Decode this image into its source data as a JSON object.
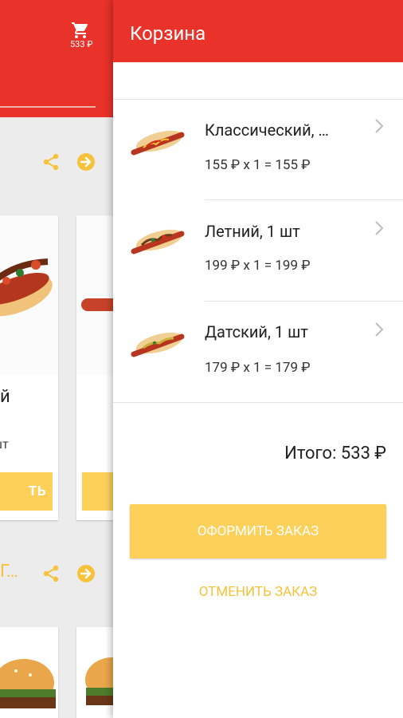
{
  "background": {
    "cart_total": "533 ₽",
    "card1": {
      "title": "й",
      "subtitle": "шт",
      "button": "ТЬ"
    },
    "section2_title": "Г…"
  },
  "cart": {
    "title": "Корзина",
    "items": [
      {
        "name": "Классический, …",
        "price_line": "155 ₽ x 1 = 155 ₽"
      },
      {
        "name": "Летний, 1 шт",
        "price_line": "199 ₽ x 1 = 199 ₽"
      },
      {
        "name": "Датский, 1 шт",
        "price_line": "179 ₽ x 1 = 179 ₽"
      }
    ],
    "total": "Итого: 533 ₽",
    "order_button": "ОФОРМИТЬ ЗАКАЗ",
    "cancel_button": "ОТМЕНИТЬ ЗАКАЗ"
  },
  "colors": {
    "header_red": "#e8322a",
    "accent_yellow": "#fdd05a",
    "accent_yellow_text": "#f6c23a"
  }
}
